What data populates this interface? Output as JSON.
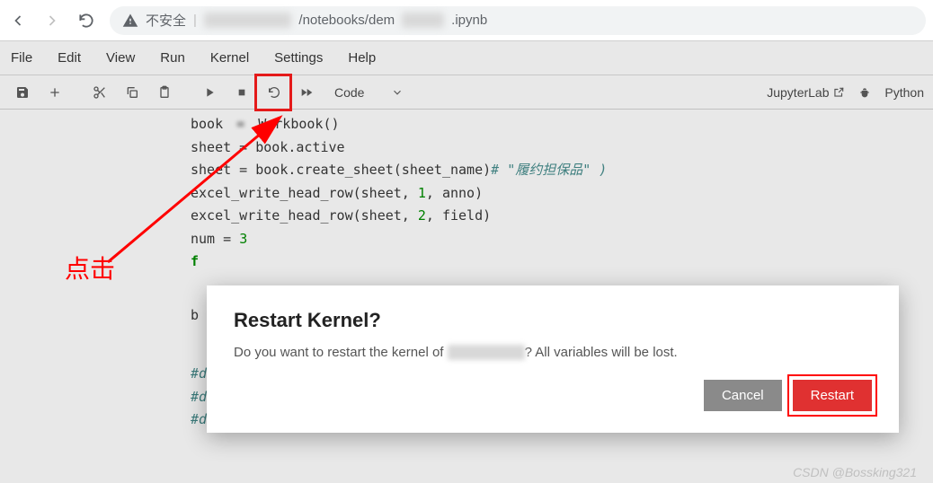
{
  "browser": {
    "insecure_label": "不安全",
    "url_segment1": "/notebooks/dem",
    "url_segment2": ".ipynb"
  },
  "menu": {
    "file": "File",
    "edit": "Edit",
    "view": "View",
    "run": "Run",
    "kernel": "Kernel",
    "settings": "Settings",
    "help": "Help"
  },
  "toolbar": {
    "cell_type": "Code",
    "jupyter_label": "JupyterLab",
    "kernel_label": "Python"
  },
  "annotation": {
    "click": "点击"
  },
  "code": {
    "line1a": "book",
    "line1b": "Workbook()",
    "line2a": "sheet = book.active",
    "line3a": "sheet = book.create_sheet(sheet_name)",
    "line3b": "# \"履约担保品\" )",
    "line4": "excel_write_head_row(sheet, ",
    "line4n1": "1",
    "line4b": ", anno)",
    "line5": "excel_write_head_row(sheet, ",
    "line5n1": "2",
    "line5b": ", field)",
    "line6a": "num = ",
    "line6b": "3",
    "line7": "f",
    "line8": "b",
    "line9": "#datadict",
    "line10": "#datadict",
    "line11": "#datadict"
  },
  "modal": {
    "title": "Restart Kernel?",
    "text_prefix": "Do you want to restart the kernel of ",
    "text_suffix": "? All variables will be lost.",
    "cancel": "Cancel",
    "restart": "Restart"
  },
  "watermark": "CSDN @Bossking321"
}
